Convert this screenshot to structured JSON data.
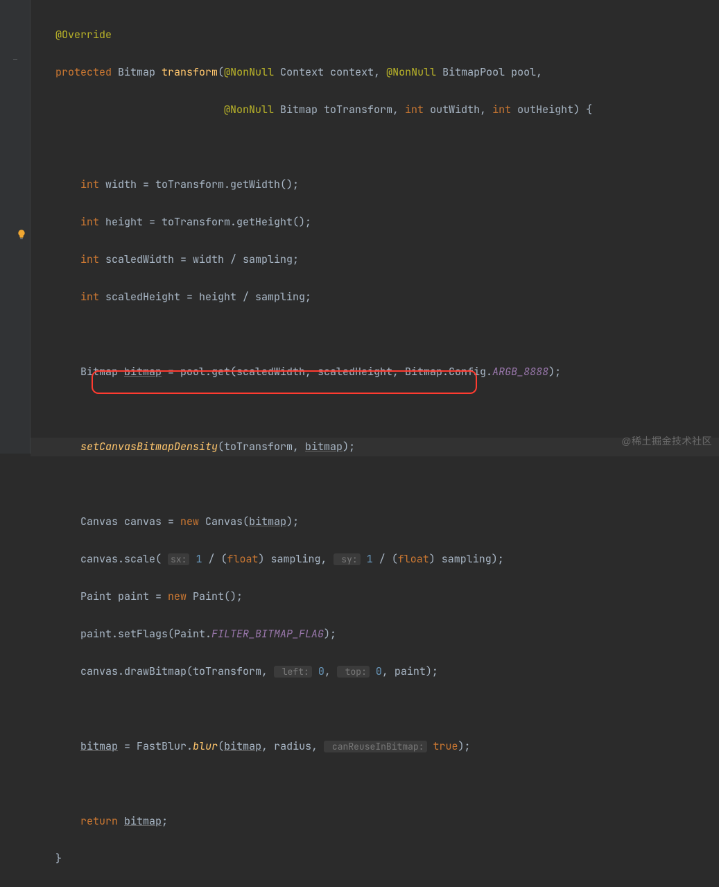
{
  "code": {
    "l0": "@Override",
    "l1a": "protected",
    "l1b": " Bitmap ",
    "l1c": "transform",
    "l1d": "(",
    "l1e": "@NonNull",
    "l1f": " Context context, ",
    "l1g": "@NonNull",
    "l1h": " BitmapPool pool,",
    "l2a": "@NonNull",
    "l2b": " Bitmap toTransform, ",
    "l2c": "int",
    "l2d": " outWidth, ",
    "l2e": "int",
    "l2f": " outHeight) {",
    "l3a": "int",
    "l3b": " width = toTransform.getWidth();",
    "l4a": "int",
    "l4b": " height = toTransform.getHeight();",
    "l5a": "int",
    "l5b": " scaledWidth = width / sampling;",
    "l6a": "int",
    "l6b": " scaledHeight = height / sampling;",
    "l7a": "Bitmap ",
    "l7b": "bitmap",
    "l7c": " = pool.get(scaledWidth, scaledHeight, Bitmap.Config.",
    "l7d": "ARGB_8888",
    "l7e": ");",
    "l8a": "setCanvasBitmapDensity",
    "l8b": "(toTransform, ",
    "l8c": "bitmap",
    "l8d": ");",
    "l9a": "Canvas canvas = ",
    "l9b": "new",
    "l9c": " Canvas(",
    "l9d": "bitmap",
    "l9e": ");",
    "l10a": "canvas.scale( ",
    "l10h1": "sx:",
    "l10b": " 1",
    "l10c": " / (",
    "l10d": "float",
    "l10e": ") sampling, ",
    "l10h2": " sy:",
    "l10f": " 1",
    "l10g": " / (",
    "l10h": "float",
    "l10i": ") sampling);",
    "l11a": "Paint paint = ",
    "l11b": "new",
    "l11c": " Paint();",
    "l12a": "paint.setFlags(Paint.",
    "l12b": "FILTER_BITMAP_FLAG",
    "l12c": ");",
    "l13a": "canvas.drawBitmap(toTransform, ",
    "l13h1": " left:",
    "l13b": " 0",
    "l13c": ", ",
    "l13h2": " top:",
    "l13d": " 0",
    "l13e": ", paint);",
    "l14a": "bitmap",
    "l14b": " = ",
    "l14c": "FastBlur.",
    "l14d": "blur",
    "l14e": "(",
    "l14f": "bitmap",
    "l14g": ", radius, ",
    "l14h1": " canReuseInBitmap:",
    "l14h": " true",
    "l14i": ");",
    "l15a": "return",
    "l15b": " ",
    "l15c": "bitmap",
    "l15d": ";",
    "l16": "}"
  },
  "watermark": "@稀土掘金技术社区"
}
